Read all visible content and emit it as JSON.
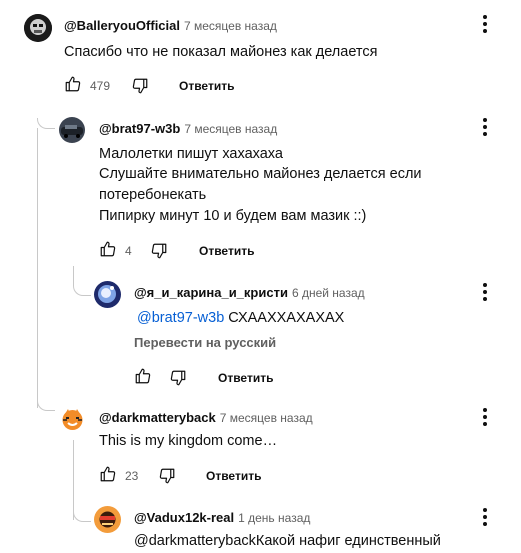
{
  "comments": [
    {
      "handle": "@BalleryouOfficial",
      "time": "7 месяцев назад",
      "lines": [
        "Спасибо что не показал майонез как делается"
      ],
      "likes": "479",
      "reply_label": "Ответить"
    },
    {
      "handle": "@brat97-w3b",
      "time": "7 месяцев назад",
      "lines": [
        "Малолетки пишут хахахаха",
        "Слушайте внимательно майонез делается если",
        "потеребонекать",
        "Пипирку минут 10 и будем вам мазик ::)"
      ],
      "likes": "4",
      "reply_label": "Ответить"
    },
    {
      "handle": "@я_и_карина_и_кристи",
      "time": "6 дней назад",
      "mention": "@brat97-w3b",
      "text": " СХААХХАХАХАХ",
      "translate_label": "Перевести на русский",
      "reply_label": "Ответить"
    },
    {
      "handle": "@darkmatteryback",
      "time": "7 месяцев назад",
      "lines": [
        "This is my kingdom come…"
      ],
      "likes": "23",
      "reply_label": "Ответить"
    },
    {
      "handle": "@Vadux12k-real",
      "time": "1 день назад",
      "lines": [
        "@darkmatterybackКакой нафиг единственный"
      ]
    }
  ],
  "colors": {
    "link": "#065fd4",
    "muted": "#606060",
    "text": "#0f0f0f",
    "thread_line": "#c8c8c8"
  },
  "icons": [
    "thumb-up-icon",
    "thumb-down-icon",
    "more-vert-icon"
  ]
}
